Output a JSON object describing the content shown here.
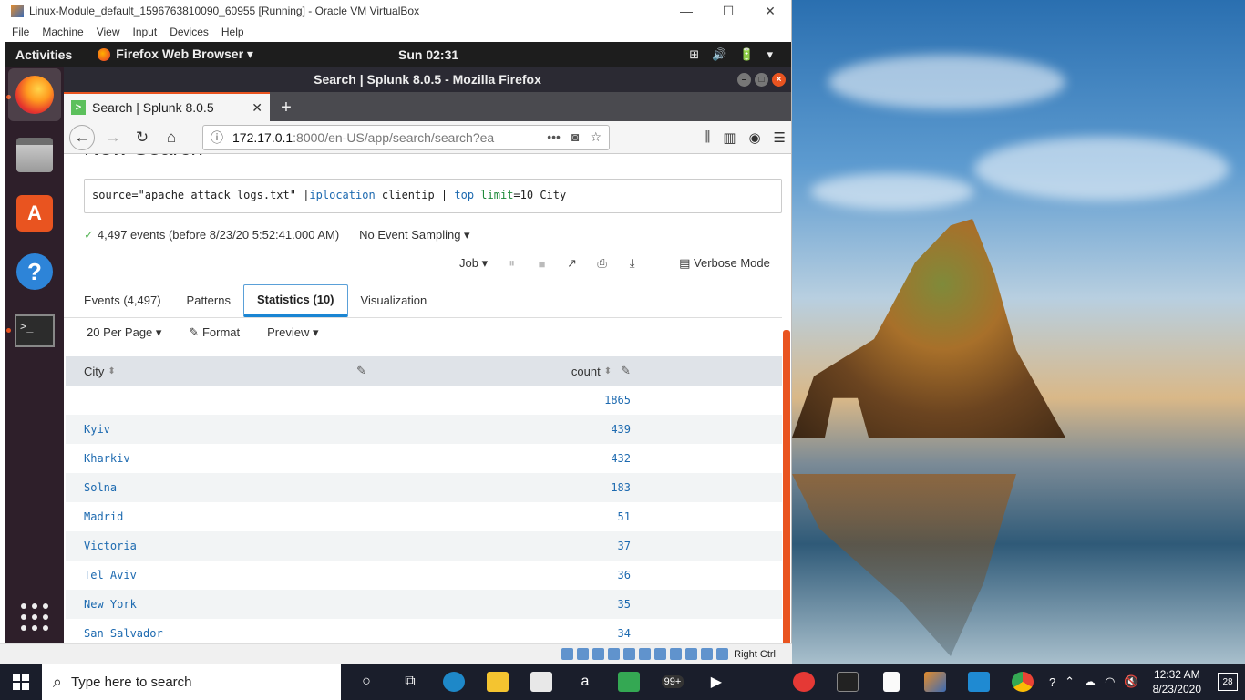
{
  "vbox": {
    "title": "Linux-Module_default_1596763810090_60955 [Running] - Oracle VM VirtualBox",
    "minimize": "—",
    "maximize": "☐",
    "close": "✕",
    "menu": [
      "File",
      "Machine",
      "View",
      "Input",
      "Devices",
      "Help"
    ],
    "status_right": "Right Ctrl"
  },
  "gnome": {
    "activities": "Activities",
    "app": "Firefox Web Browser ▾",
    "clock": "Sun 02:31",
    "tray": [
      "⊞",
      "🔊",
      "🔋",
      "▾"
    ]
  },
  "dock": {
    "store_glyph": "A",
    "help_glyph": "?",
    "terminal_glyph": ">_"
  },
  "firefox": {
    "window_title": "Search | Splunk 8.0.5 - Mozilla Firefox",
    "tab_label": "Search | Splunk 8.0.5",
    "tab_favicon": ">",
    "tab_close": "✕",
    "new_tab": "+",
    "url_host": "172.17.0.1",
    "url_path": ":8000/en-US/app/search/search?ea",
    "url_more": "•••",
    "back": "←",
    "forward": "→",
    "reload": "↻",
    "home": "⌂",
    "menu": "☰"
  },
  "splunk": {
    "heading": "New Search",
    "query": {
      "p1": "source=\"apache_attack_logs.txt\" |",
      "cmd1": "iplocation",
      "p2": " clientip | ",
      "cmd2": "top",
      "p3": " ",
      "arg": "limit",
      "p4": "=10 City"
    },
    "events_text": "4,497 events (before 8/23/20 5:52:41.000 AM)",
    "sampling": "No Event Sampling ▾",
    "job": "Job ▾",
    "verbose": "Verbose Mode",
    "tabs": [
      "Events (4,497)",
      "Patterns",
      "Statistics (10)",
      "Visualization"
    ],
    "options": {
      "per_page": "20 Per Page ▾",
      "format": "Format",
      "preview": "Preview ▾"
    },
    "columns": {
      "city": "City",
      "count": "count"
    },
    "rows": [
      {
        "city": "",
        "count": "1865"
      },
      {
        "city": "Kyiv",
        "count": "439"
      },
      {
        "city": "Kharkiv",
        "count": "432"
      },
      {
        "city": "Solna",
        "count": "183"
      },
      {
        "city": "Madrid",
        "count": "51"
      },
      {
        "city": "Victoria",
        "count": "37"
      },
      {
        "city": "Tel Aviv",
        "count": "36"
      },
      {
        "city": "New York",
        "count": "35"
      },
      {
        "city": "San Salvador",
        "count": "34"
      }
    ]
  },
  "taskbar": {
    "search_placeholder": "Type here to search",
    "time": "12:32 AM",
    "date": "8/23/2020",
    "notifications": "28",
    "badge": "99+"
  },
  "colors": {
    "ubuntu_orange": "#e95420",
    "splunk_link": "#1d6ab0",
    "selected_tab": "#1a85d3"
  }
}
